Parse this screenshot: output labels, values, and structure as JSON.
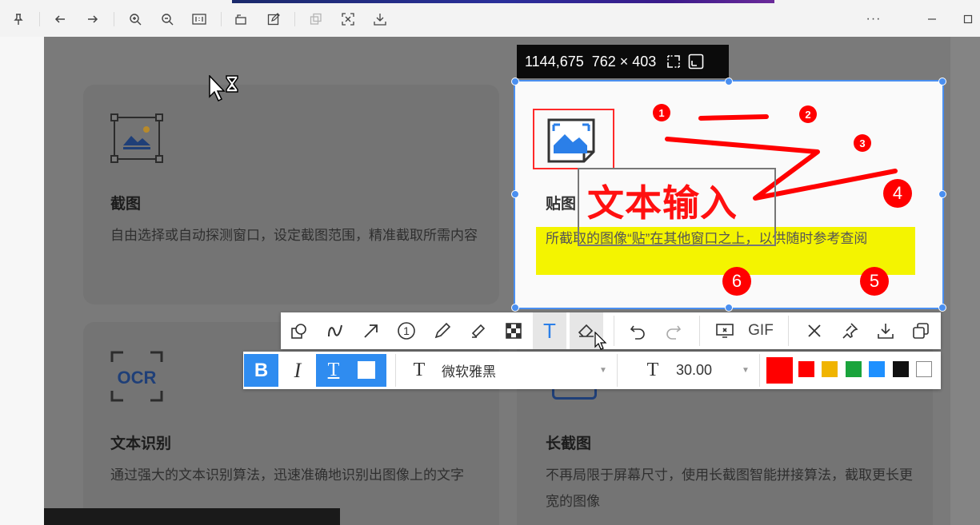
{
  "viewer_toolbar": {
    "icons": [
      "pin-icon",
      "back-arrow-icon",
      "forward-arrow-icon",
      "zoom-in-icon",
      "zoom-out-icon",
      "actual-size-icon",
      "rotate-icon",
      "edit-icon",
      "copy-icon",
      "ocr-scan-icon",
      "download-icon",
      "more-icon",
      "minimize-icon",
      "maximize-icon"
    ],
    "more_label": "···"
  },
  "cards": [
    {
      "title": "截图",
      "desc": "自由选择或自动探测窗口，设定截图范围，精准截取所需内容",
      "icon": "screenshot-icon"
    },
    {
      "title": "文本识别",
      "desc": "通过强大的文本识别算法，迅速准确地识别出图像上的文字",
      "icon": "ocr-icon",
      "icon_text": "OCR"
    },
    {
      "title": "长截图",
      "desc": "不再局限于屏幕尺寸，使用长截图智能拼接算法，截取更长更宽的图像",
      "icon": "long-screenshot-icon"
    }
  ],
  "selection": {
    "readout": "1144,675  762 × 403",
    "sel_title": "贴图",
    "sel_desc": "所截取的图像“贴”在其他窗口之上，以供随时参考查阅",
    "text_annotation": "文本输入",
    "numbers": [
      "1",
      "2",
      "3",
      "4",
      "5",
      "6"
    ]
  },
  "annotation_toolbar": {
    "tools": [
      "shape-icon",
      "curve-icon",
      "arrow-icon",
      "number-marker-icon",
      "pencil-icon",
      "highlighter-icon",
      "mosaic-icon",
      "text-tool-icon",
      "eraser-icon",
      "undo-icon",
      "redo-icon",
      "scroll-capture-icon",
      "gif-icon",
      "close-icon",
      "pin-to-screen-icon",
      "save-icon",
      "copy-icon"
    ],
    "gif_label": "GIF",
    "number_label": "1",
    "text_label": "T"
  },
  "text_props": {
    "bold": "B",
    "italic": "I",
    "outline": "T",
    "font_label": "T",
    "font_name": "微软雅黑",
    "size_label": "T",
    "font_size": "30.00",
    "current_color": "#ff0000",
    "colors": [
      "#ff0000",
      "#f0b400",
      "#1aa43c",
      "#1e90ff",
      "#111111",
      "#ffffff"
    ]
  }
}
